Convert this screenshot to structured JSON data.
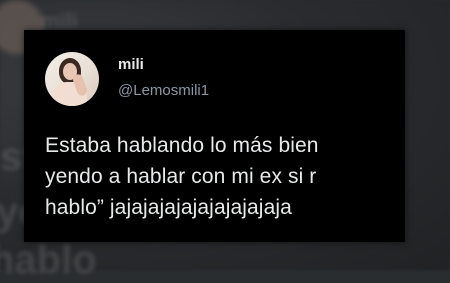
{
  "tweet": {
    "display_name": "mili",
    "handle": "@Lemosmili1",
    "text_lines": [
      "Estaba hablando lo más bien",
      "yendo a hablar con mi ex si r",
      "hablo” jajajajajajajajajajaja"
    ]
  },
  "background": {
    "blurred_lines": [
      "stab",
      "yen",
      "hablo",
      "mili"
    ]
  },
  "icons": {
    "avatar": "profile-photo"
  },
  "colors": {
    "card_bg": "#000000",
    "primary_text": "#e7e9ea",
    "secondary_text": "#8b98a5",
    "backdrop": "#2a2d30"
  }
}
